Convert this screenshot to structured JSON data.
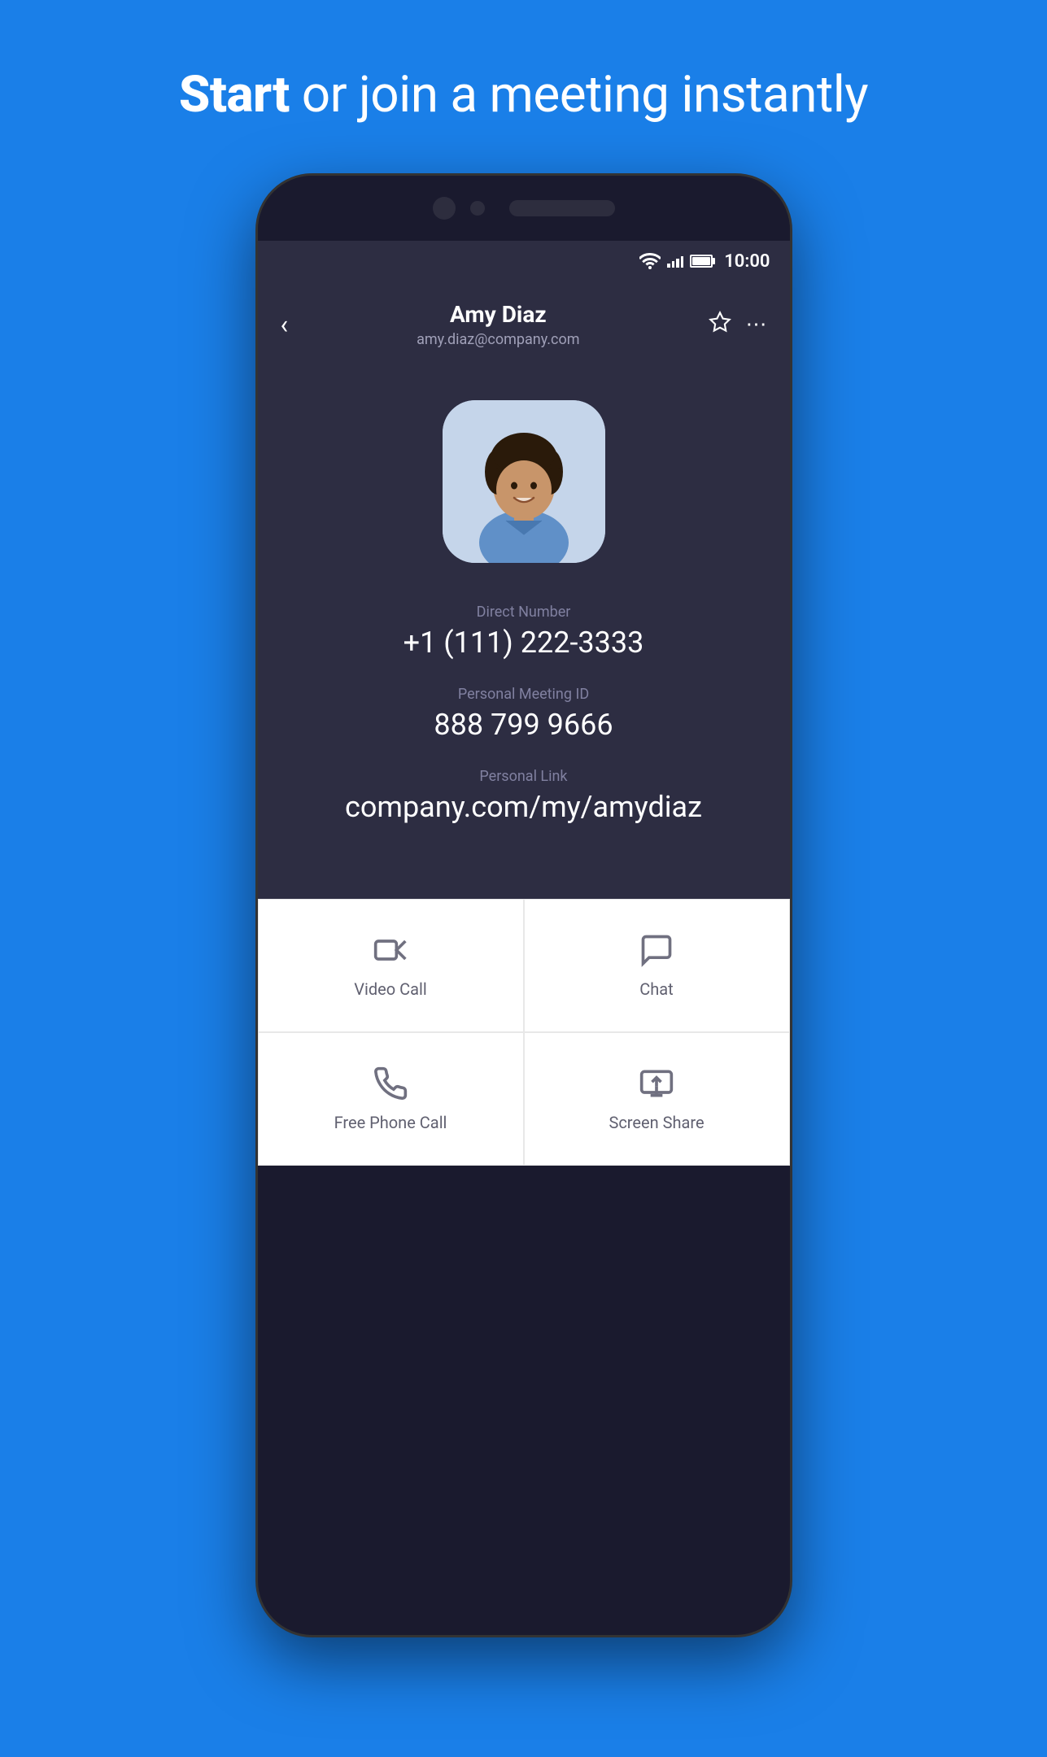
{
  "header": {
    "title_bold": "Start",
    "title_rest": " or join a meeting instantly"
  },
  "status_bar": {
    "time": "10:00"
  },
  "contact": {
    "name": "Amy Diaz",
    "email": "amy.diaz@company.com",
    "direct_number_label": "Direct Number",
    "direct_number": "+1 (111) 222-3333",
    "meeting_id_label": "Personal Meeting ID",
    "meeting_id": "888 799 9666",
    "personal_link_label": "Personal Link",
    "personal_link": "company.com/my/amydiaz"
  },
  "actions": {
    "video_call": "Video Call",
    "chat": "Chat",
    "free_phone_call": "Free Phone Call",
    "screen_share": "Screen Share"
  }
}
